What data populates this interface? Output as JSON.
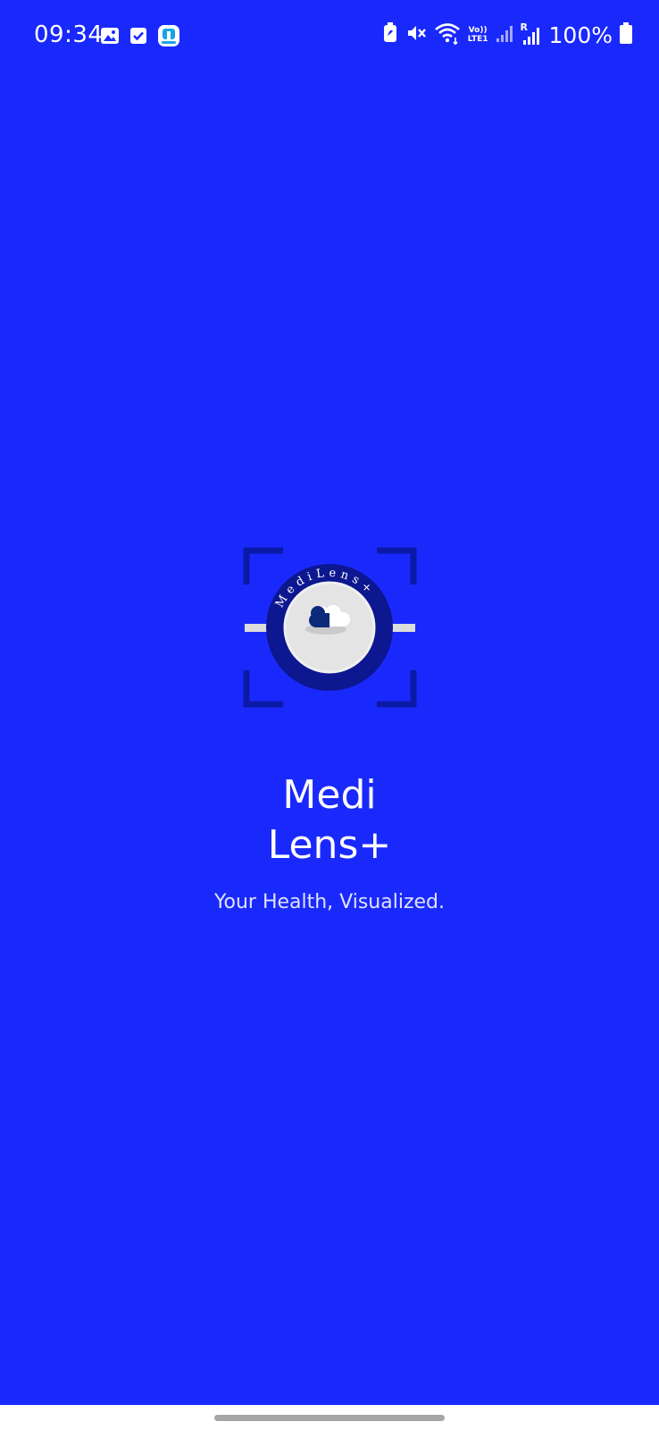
{
  "status_bar": {
    "time": "09:34",
    "battery_percent": "100%",
    "network_label_top": "Vo))",
    "network_label_bottom": "LTE1",
    "sim_label": "R",
    "left_icons": [
      "gallery-notification-icon",
      "task-check-icon",
      "app-notification-icon"
    ],
    "right_icons": [
      "battery-saver-icon",
      "mute-icon",
      "wifi-icon",
      "signal-icon",
      "signal-roaming-icon",
      "battery-icon"
    ]
  },
  "splash": {
    "logo_ring_text": "MediLens+",
    "title_line1": "Medi",
    "title_line2": "Lens+",
    "tagline": "Your Health, Visualized."
  },
  "colors": {
    "background": "#1a29fb",
    "logo_frame": "#0b1aa6",
    "logo_ring": "#0c1790",
    "logo_inner": "#e4e4e4",
    "pill_dark": "#0b2a7a",
    "nav_bar": "#ffffff",
    "home_indicator": "#a6a6a6"
  }
}
